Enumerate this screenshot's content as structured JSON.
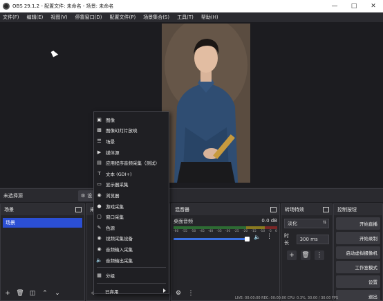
{
  "window": {
    "title": "OBS 29.1.2 - 配置文件: 未命名 - 场景: 未命名"
  },
  "menubar": [
    "文件(F)",
    "编辑(E)",
    "视图(V)",
    "停靠窗口(D)",
    "配置文件(P)",
    "场景集合(S)",
    "工具(T)",
    "帮助(H)"
  ],
  "source_bar": {
    "no_source": "未选择源",
    "properties_label": "设"
  },
  "scenes": {
    "title": "场景",
    "items": [
      "场景"
    ]
  },
  "sources": {
    "title": "来"
  },
  "mixer": {
    "title": "混音器",
    "channel": {
      "name": "桌面音频",
      "level": "0.0 dB"
    },
    "ticks": [
      "-60",
      "-55",
      "-50",
      "-45",
      "-40",
      "-35",
      "-30",
      "-25",
      "-20",
      "-15",
      "-10",
      "-5",
      "0"
    ],
    "volume_level": 0.9
  },
  "transitions": {
    "title": "转场特效",
    "selected": "淡化",
    "duration_label": "时长",
    "duration_value": "300 ms"
  },
  "controls": {
    "title": "控制按钮",
    "buttons": [
      "开始直播",
      "开始录制",
      "启动虚拟摄像机",
      "工作室模式",
      "设置",
      "退出"
    ]
  },
  "context_menu": {
    "items": [
      {
        "icon": "image-icon",
        "label": "图像"
      },
      {
        "icon": "slideshow-icon",
        "label": "图像幻灯片放映"
      },
      {
        "icon": "list-icon",
        "label": "场景"
      },
      {
        "icon": "media-icon",
        "label": "媒体源"
      },
      {
        "icon": "app-audio-icon",
        "label": "应用程序音频采集（测试）"
      },
      {
        "icon": "text-icon",
        "label": "文本 (GDI+)"
      },
      {
        "icon": "monitor-icon",
        "label": "显示器采集"
      },
      {
        "icon": "globe-icon",
        "label": "浏览器"
      },
      {
        "icon": "gamepad-icon",
        "label": "游戏采集"
      },
      {
        "icon": "window-icon",
        "label": "窗口采集"
      },
      {
        "icon": "brush-icon",
        "label": "色源"
      },
      {
        "icon": "camera-icon",
        "label": "视频采集设备"
      },
      {
        "icon": "microphone-icon",
        "label": "音频输入采集"
      },
      {
        "icon": "speaker-icon",
        "label": "音频输出采集"
      }
    ],
    "group_label": "分组",
    "deprecated_label": "已弃用"
  },
  "status": {
    "text": "LIVE: 00:00:00  REC: 00:00:00  CPU: 0.3%, 30.00 / 30.00 FPS"
  }
}
